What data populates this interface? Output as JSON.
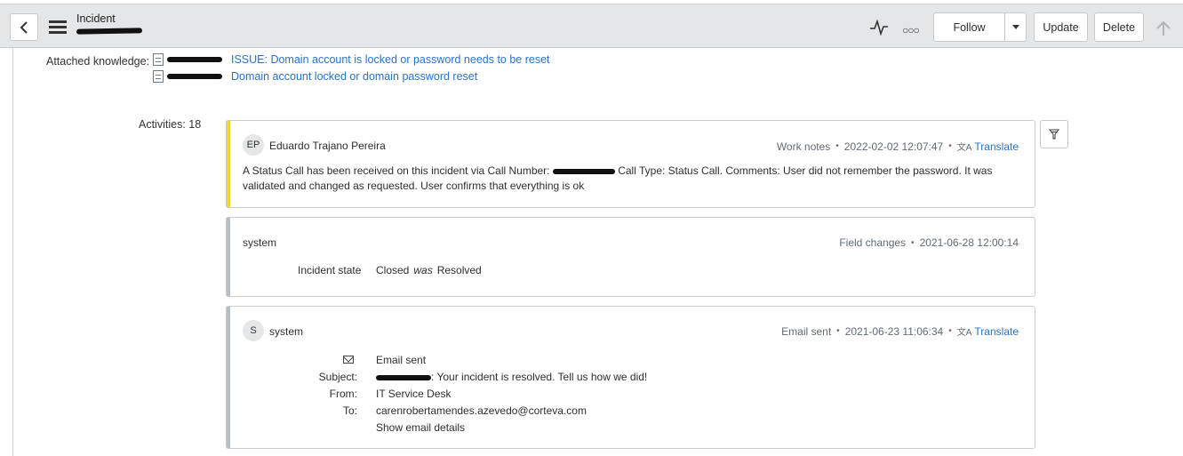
{
  "header": {
    "title": "Incident",
    "follow_label": "Follow",
    "update_label": "Update",
    "delete_label": "Delete"
  },
  "knowledge": {
    "label": "Attached knowledge:",
    "articles": [
      {
        "title": "ISSUE: Domain account is locked or password needs to be reset"
      },
      {
        "title": "Domain account locked or domain password reset"
      }
    ]
  },
  "activities": {
    "label": "Activities: 18",
    "entries": [
      {
        "initials": "EP",
        "author": "Eduardo Trajano Pereira",
        "type": "Work notes",
        "timestamp": "2022-02-02 12:07:47",
        "translate": "Translate",
        "text_part1": "A Status Call has been received on this incident via Call Number:",
        "text_part2": "Call Type: Status Call. Comments: User did not remember the password. It was validated and changed as requested. User confirms that everything is ok",
        "accent": "#f4d03f"
      },
      {
        "author": "system",
        "type": "Field changes",
        "timestamp": "2021-06-28 12:00:14",
        "field": "Incident state",
        "new_value": "Closed",
        "was": "was",
        "old_value": "Resolved",
        "accent": "#b9bec2"
      },
      {
        "initials": "S",
        "author": "system",
        "type": "Email sent",
        "timestamp": "2021-06-23 11:06:34",
        "translate": "Translate",
        "email_heading": "Email sent",
        "subject_label": "Subject:",
        "subject_value": ": Your incident is resolved. Tell us how we did!",
        "from_label": "From:",
        "from_value": "IT Service Desk",
        "to_label": "To:",
        "to_value": "carenrobertamendes.azevedo@corteva.com",
        "show_details": "Show email details",
        "accent": "#b9bec2"
      }
    ]
  },
  "icons": [
    "back-icon",
    "menu-icon",
    "activity-pulse-icon",
    "more-icon",
    "chevron-down-icon",
    "scroll-top-icon",
    "document-icon",
    "filter-icon",
    "translate-icon",
    "mail-icon"
  ],
  "colors": {
    "link": "#2a72c8",
    "work_note_accent": "#f4d03f",
    "header_bg": "#e4e6e7"
  }
}
